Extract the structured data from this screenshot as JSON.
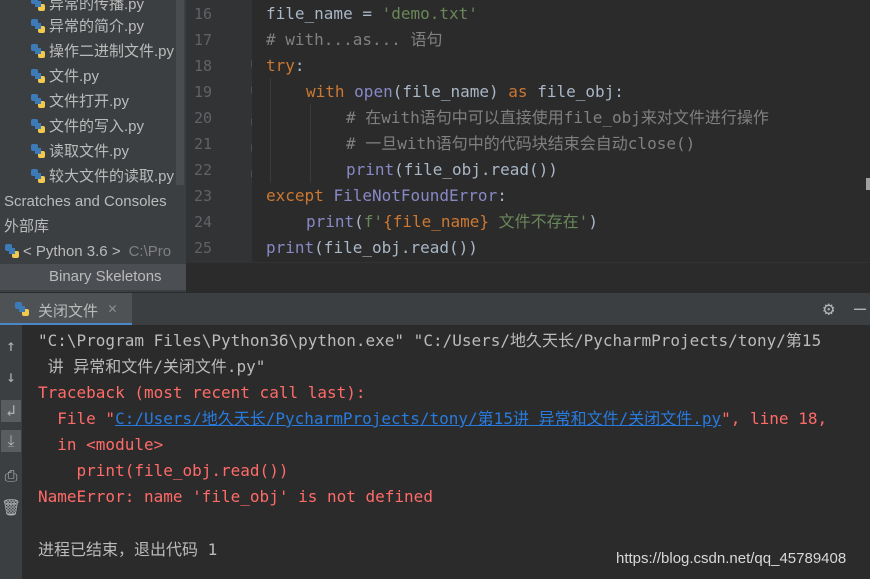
{
  "project_tree": {
    "files": [
      "异常的传播.py",
      "异常的简介.py",
      "操作二进制文件.py",
      "文件.py",
      "文件打开.py",
      "文件的写入.py",
      "读取文件.py",
      "较大文件的读取.py"
    ],
    "scratches_label": "Scratches and Consoles",
    "external_libraries_label": "外部库",
    "python_sdk_label": "< Python 3.6 >",
    "python_sdk_path": "C:\\Pro",
    "binary_skeletons_label": "Binary Skeletons"
  },
  "editor": {
    "line_numbers": [
      "16",
      "17",
      "18",
      "19",
      "20",
      "21",
      "22",
      "23",
      "24",
      "25"
    ],
    "lines": {
      "l16": {
        "var": "file_name",
        "op": " = ",
        "str": "'demo.txt'"
      },
      "l17": {
        "comment": "# with...as... 语句"
      },
      "l18": {
        "kw": "try",
        "punct": ":"
      },
      "l19": {
        "kw1": "with",
        "bi": "open",
        "args": "(file_name) ",
        "kw2": "as",
        "rest": " file_obj:"
      },
      "l20": {
        "comment": "# 在with语句中可以直接使用file_obj来对文件进行操作"
      },
      "l21": {
        "comment": "# 一旦with语句中的代码块结束会自动close()"
      },
      "l22": {
        "bi": "print",
        "rest": "(file_obj.read())"
      },
      "l23": {
        "kw": "except",
        "bi": "FileNotFoundError",
        "punct": ":"
      },
      "l24": {
        "bi": "print",
        "open": "(",
        "fstr_a": "f'",
        "fexpr": "{file_name}",
        "fstr_b": " 文件不存在'",
        "close": ")"
      },
      "l25": {
        "bi": "print",
        "rest": "(file_obj.read())"
      }
    }
  },
  "run_panel": {
    "tab_label": "关闭文件",
    "console": {
      "cmd_line_1": "\"C:\\Program Files\\Python36\\python.exe\" \"C:/Users/地久天长/PycharmProjects/tony/第15",
      "cmd_line_2": " 讲 异常和文件/关闭文件.py\"",
      "traceback_header": "Traceback (most recent call last):",
      "file_prefix": "  File \"",
      "file_link": "C:/Users/地久天长/PycharmProjects/tony/第15讲 异常和文件/关闭文件.py",
      "file_suffix": "\", line 18,",
      "in_module": "  in <module>",
      "code_line": "    print(file_obj.read())",
      "error_line": "NameError: name 'file_obj' is not defined",
      "exit_line": "进程已结束，退出代码 1"
    }
  },
  "watermark": "https://blog.csdn.net/qq_45789408",
  "colors": {
    "keyword": "#cc7832",
    "string": "#6a8759",
    "comment": "#808080",
    "builtin": "#8888c6",
    "error": "#ff6b68",
    "link": "#287bde"
  }
}
